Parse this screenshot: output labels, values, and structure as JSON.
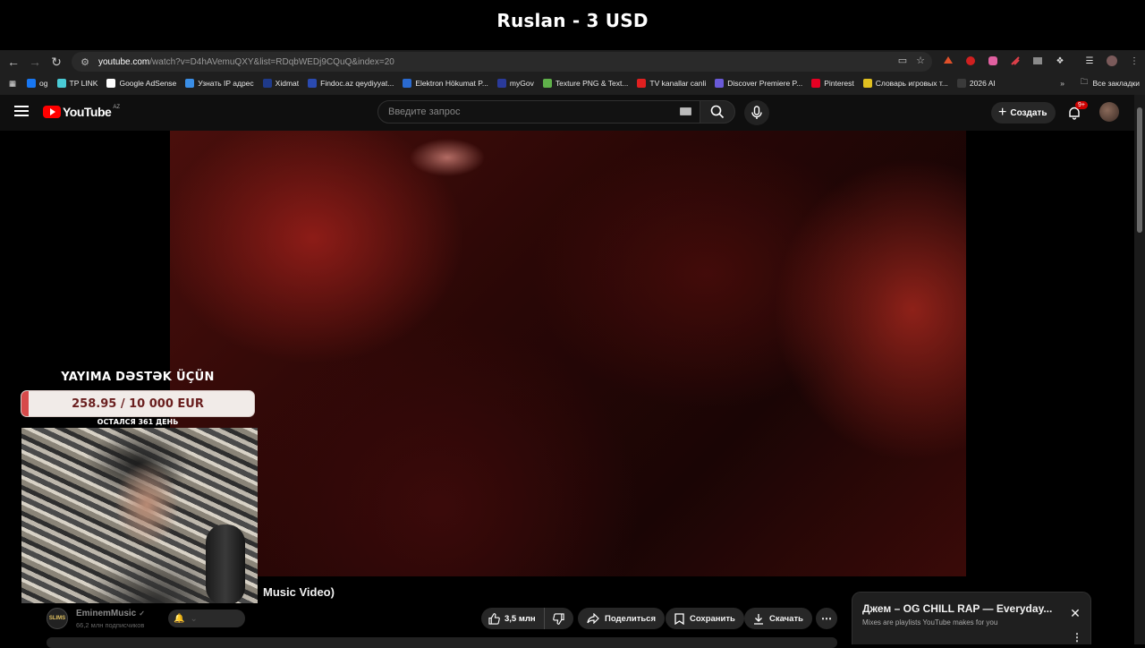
{
  "stream": {
    "title": "Ruslan - 3 USD"
  },
  "browser": {
    "url_host": "youtube.com",
    "url_path": "/watch?v=D4hAVemuQXY&list=RDqbWEDj9CQuQ&index=20",
    "bookmarks": [
      {
        "label": "og",
        "color": "#1877f2"
      },
      {
        "label": "TP LINK",
        "color": "#4acbd6"
      },
      {
        "label": "Google AdSense",
        "color": "#ffffff"
      },
      {
        "label": "Узнать IP адрес",
        "color": "#3a8ee6"
      },
      {
        "label": "Xidmat",
        "color": "#1f3a8a"
      },
      {
        "label": "Findoc.az qeydiyyat...",
        "color": "#2a4ab0"
      },
      {
        "label": "Elektron Hökumat P...",
        "color": "#2a6ad0"
      },
      {
        "label": "myGov",
        "color": "#2a3a9a"
      },
      {
        "label": "Texture PNG & Text...",
        "color": "#5fb04a"
      },
      {
        "label": "TV kanallar canli",
        "color": "#e02020"
      },
      {
        "label": "Discover Premiere P...",
        "color": "#6a5ad8"
      },
      {
        "label": "Pinterest",
        "color": "#e60023"
      },
      {
        "label": "Словарь игровых т...",
        "color": "#e0c020"
      },
      {
        "label": "2026 AI",
        "color": "#3a3a3a"
      }
    ],
    "all_bookmarks_label": "Все закладки",
    "extension_colors": [
      "#e0502a",
      "#d02020",
      "#e060a0",
      "#e0404a",
      "#8a8a8a"
    ]
  },
  "youtube": {
    "logo_text": "YouTube",
    "country_code": "AZ",
    "search_placeholder": "Введите запрос",
    "create_label": "Создать",
    "notifications_badge": "9+"
  },
  "overlay": {
    "title": "YAYIMA DƏSTƏK ÜÇÜN",
    "amount": "258.95 / 10 000 EUR",
    "progress_fraction": 0.026,
    "days_left": "ОСТАЛСЯ 361 ДЕНЬ",
    "accent_color": "#d64a4a"
  },
  "video": {
    "title_fragment": "Music Video)",
    "channel_name": "EminemMusic",
    "channel_check": "✓",
    "channel_avatar_text": "SLIMS",
    "subscribers": "66,2 млн подписчиков",
    "likes": "3,5 млн",
    "share_label": "Поделиться",
    "save_label": "Сохранить",
    "download_label": "Скачать"
  },
  "mix": {
    "title": "Джем – OG CHILL RAP — Everyday...",
    "subtitle": "Mixes are playlists YouTube makes for you"
  }
}
